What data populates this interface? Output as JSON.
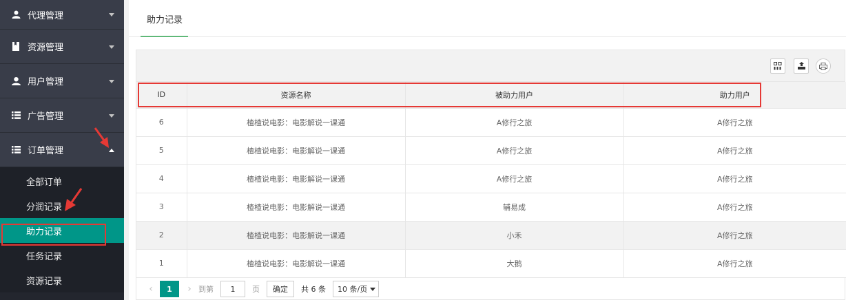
{
  "sidebar": {
    "menus": [
      {
        "label": "代理管理",
        "icon": "user-group-icon"
      },
      {
        "label": "资源管理",
        "icon": "bookmark-icon"
      },
      {
        "label": "用户管理",
        "icon": "user-icon"
      },
      {
        "label": "广告管理",
        "icon": "list-icon"
      },
      {
        "label": "订单管理",
        "icon": "list-icon"
      }
    ],
    "order_submenu": [
      {
        "label": "全部订单"
      },
      {
        "label": "分润记录"
      },
      {
        "label": "助力记录",
        "active": true
      },
      {
        "label": "任务记录"
      },
      {
        "label": "资源记录"
      }
    ]
  },
  "tab": {
    "label": "助力记录"
  },
  "table": {
    "columns": [
      "ID",
      "资源名称",
      "被助力用户",
      "助力用户"
    ],
    "rows": [
      [
        "6",
        "楂楂说电影：电影解说一课通",
        "A修行之旅",
        "A修行之旅"
      ],
      [
        "5",
        "楂楂说电影：电影解说一课通",
        "A修行之旅",
        "A修行之旅"
      ],
      [
        "4",
        "楂楂说电影：电影解说一课通",
        "A修行之旅",
        "A修行之旅"
      ],
      [
        "3",
        "楂楂说电影：电影解说一课通",
        "辅易成",
        "A修行之旅"
      ],
      [
        "2",
        "楂楂说电影：电影解说一课通",
        "小禾",
        "A修行之旅"
      ],
      [
        "1",
        "楂楂说电影：电影解说一课通",
        "大鹅",
        "A修行之旅"
      ]
    ]
  },
  "pager": {
    "current_page": "1",
    "goto_label": "到第",
    "goto_value": "1",
    "page_unit": "页",
    "confirm_label": "确定",
    "total_text": "共 6 条",
    "page_size": "10 条/页"
  },
  "colors": {
    "accent": "#009688",
    "sidebar_bg": "#393d49",
    "annotation": "#e53935"
  }
}
